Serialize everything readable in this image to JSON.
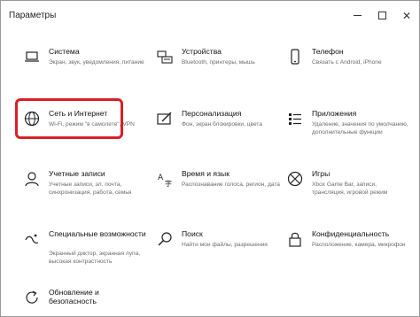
{
  "window": {
    "title": "Параметры",
    "controls": {
      "minimize": "",
      "maximize": "",
      "close": "✕"
    }
  },
  "tiles": [
    {
      "name": "Система",
      "desc": "Экран, звук, уведомления, питание",
      "icon": "laptop-icon"
    },
    {
      "name": "Устройства",
      "desc": "Bluetooth, принтеры, мышь",
      "icon": "keyboard-printer-icon"
    },
    {
      "name": "Телефон",
      "desc": "Связать с Android, iPhone",
      "icon": "phone-icon"
    },
    {
      "name": "Сеть и Интернет",
      "desc": "Wi-Fi, режим \"в самолете\", VPN",
      "icon": "globe-icon"
    },
    {
      "name": "Персонализация",
      "desc": "Фон, экран блокировки, цвета",
      "icon": "personalization-icon"
    },
    {
      "name": "Приложения",
      "desc": "Удаление, значения по умолчанию, дополнительные функции",
      "icon": "apps-list-icon"
    },
    {
      "name": "Учетные записи",
      "desc": "Учетные записи, эл. почта, синхронизация, работа, семья",
      "icon": "person-icon"
    },
    {
      "name": "Время и язык",
      "desc": "Распознавание голоса, регион, дата",
      "icon": "time-language-icon"
    },
    {
      "name": "Игры",
      "desc": "Xbox Game Bar, записи, трансляция, игровой режим",
      "icon": "xbox-icon"
    },
    {
      "name": "Специальные возможности",
      "desc": "Экранный диктор, экранная лупа, высокая контрастность",
      "icon": "ease-of-access-icon"
    },
    {
      "name": "Поиск",
      "desc": "Найти мои файлы, разрешения",
      "icon": "search-icon"
    },
    {
      "name": "Конфиденциальность",
      "desc": "Расположение, камера, микрофон",
      "icon": "lock-icon"
    },
    {
      "name": "Обновление и безопасность",
      "desc": "",
      "icon": "refresh-icon"
    }
  ]
}
